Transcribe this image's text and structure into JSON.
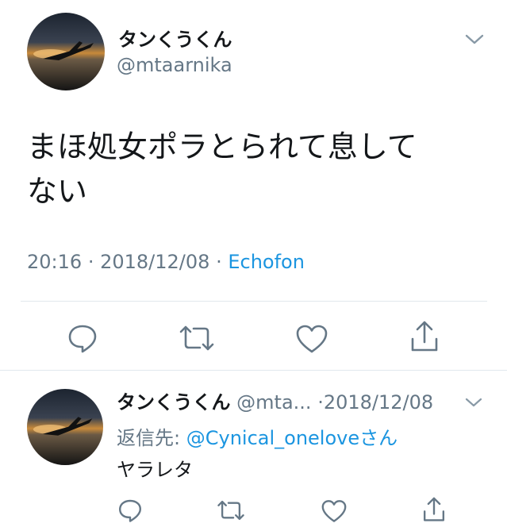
{
  "main_tweet": {
    "display_name": "タンくうくん",
    "handle": "@mtaarnika",
    "text_line1": "まほ処女ポラとられて息して",
    "text_line2": "ない",
    "time": "20:16",
    "separator": "·",
    "date": "2018/12/08",
    "client": "Echofon"
  },
  "actions": {
    "reply": "reply-icon",
    "retweet": "retweet-icon",
    "like": "heart-icon",
    "share": "share-icon"
  },
  "reply_tweet": {
    "display_name": "タンくうくん",
    "handle": "@mta...",
    "date_sep": "·",
    "date": "2018/12/08",
    "reply_to_label": "返信先:",
    "reply_to_user": "@Cynical_oneloveさん",
    "text": "ヤラレタ"
  },
  "colors": {
    "text": "#14171a",
    "secondary": "#657786",
    "link": "#1b95e0",
    "divider": "#e1e8ed"
  }
}
